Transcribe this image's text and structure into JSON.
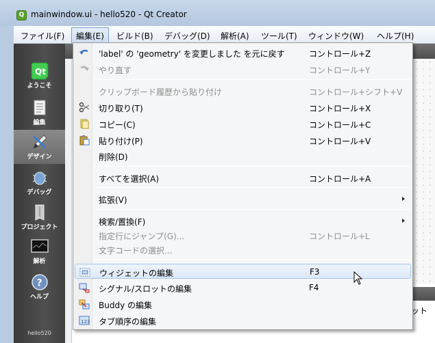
{
  "window": {
    "title": "mainwindow.ui - hello520 - Qt Creator"
  },
  "menubar": [
    "ファイル(F)",
    "編集(E)",
    "ビルド(B)",
    "デバッグ(D)",
    "解析(A)",
    "ツール(T)",
    "ウィンドウ(W)",
    "ヘルプ(H)"
  ],
  "sidebar": {
    "items": [
      {
        "label": "ようこそ",
        "icon": "qt-logo-icon"
      },
      {
        "label": "編集",
        "icon": "document-icon"
      },
      {
        "label": "デザイン",
        "icon": "design-pencil-icon"
      },
      {
        "label": "デバッグ",
        "icon": "bug-icon"
      },
      {
        "label": "プロジェクト",
        "icon": "project-icon"
      },
      {
        "label": "解析",
        "icon": "monitor-icon"
      },
      {
        "label": "ヘルプ",
        "icon": "help-icon"
      }
    ],
    "project": "hello520"
  },
  "editor": {
    "lower_text": "ット"
  },
  "edit_menu": {
    "items": [
      {
        "label": "'label' の 'geometry' を変更しました を元に戻す",
        "shortcut": "コントロール+Z",
        "icon": "undo-icon",
        "disabled": false
      },
      {
        "label": "やり直す",
        "shortcut": "コントロール+Y",
        "icon": "redo-icon",
        "disabled": true
      },
      {
        "label": "クリップボード履歴から貼り付け",
        "shortcut": "コントロール+シフト+V",
        "disabled": true
      },
      {
        "label": "切り取り(T)",
        "shortcut": "コントロール+X",
        "icon": "cut-icon",
        "disabled": false
      },
      {
        "label": "コピー(C)",
        "shortcut": "コントロール+C",
        "icon": "copy-icon",
        "disabled": false
      },
      {
        "label": "貼り付け(P)",
        "shortcut": "コントロール+V",
        "icon": "paste-icon",
        "disabled": false
      },
      {
        "label": "削除(D)",
        "shortcut": "",
        "disabled": false
      },
      {
        "label": "すべてを選択(A)",
        "shortcut": "コントロール+A",
        "disabled": false
      },
      {
        "label": "拡張(V)",
        "shortcut": "",
        "disabled": false,
        "submenu": true
      },
      {
        "label": "検索/置換(F)",
        "shortcut": "",
        "disabled": false,
        "submenu": true
      },
      {
        "label": "指定行にジャンプ(G)...",
        "shortcut": "コントロール+L",
        "disabled": true
      },
      {
        "label": "文字コードの選択...",
        "shortcut": "",
        "disabled": true
      },
      {
        "label": "ウィジェットの編集",
        "shortcut": "F3",
        "icon": "widget-edit-icon",
        "disabled": false,
        "highlighted": true
      },
      {
        "label": "シグナル/スロットの編集",
        "shortcut": "F4",
        "icon": "signal-slot-icon",
        "disabled": false
      },
      {
        "label": "Buddy の編集",
        "shortcut": "",
        "icon": "buddy-icon",
        "disabled": false
      },
      {
        "label": "タブ順序の編集",
        "shortcut": "",
        "icon": "tab-order-icon",
        "disabled": false
      }
    ]
  }
}
